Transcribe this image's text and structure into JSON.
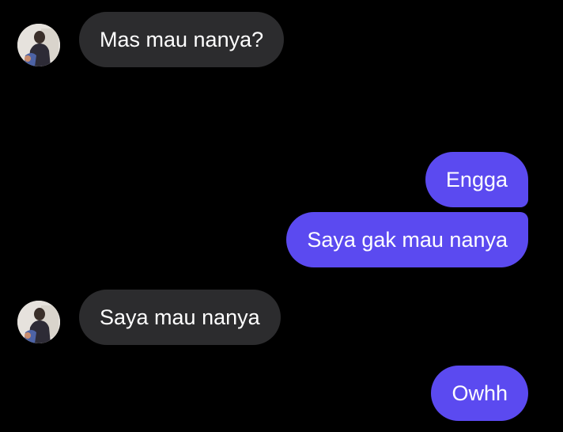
{
  "messages": [
    {
      "sender": "other",
      "text": "Mas mau nanya?"
    },
    {
      "sender": "me",
      "text": "Engga"
    },
    {
      "sender": "me",
      "text": "Saya gak mau nanya"
    },
    {
      "sender": "other",
      "text": "Saya mau nanya"
    },
    {
      "sender": "me",
      "text": "Owhh"
    }
  ],
  "colors": {
    "background": "#000000",
    "incoming_bubble": "#2c2c2e",
    "outgoing_bubble": "#5b4af0",
    "text": "#ffffff"
  }
}
